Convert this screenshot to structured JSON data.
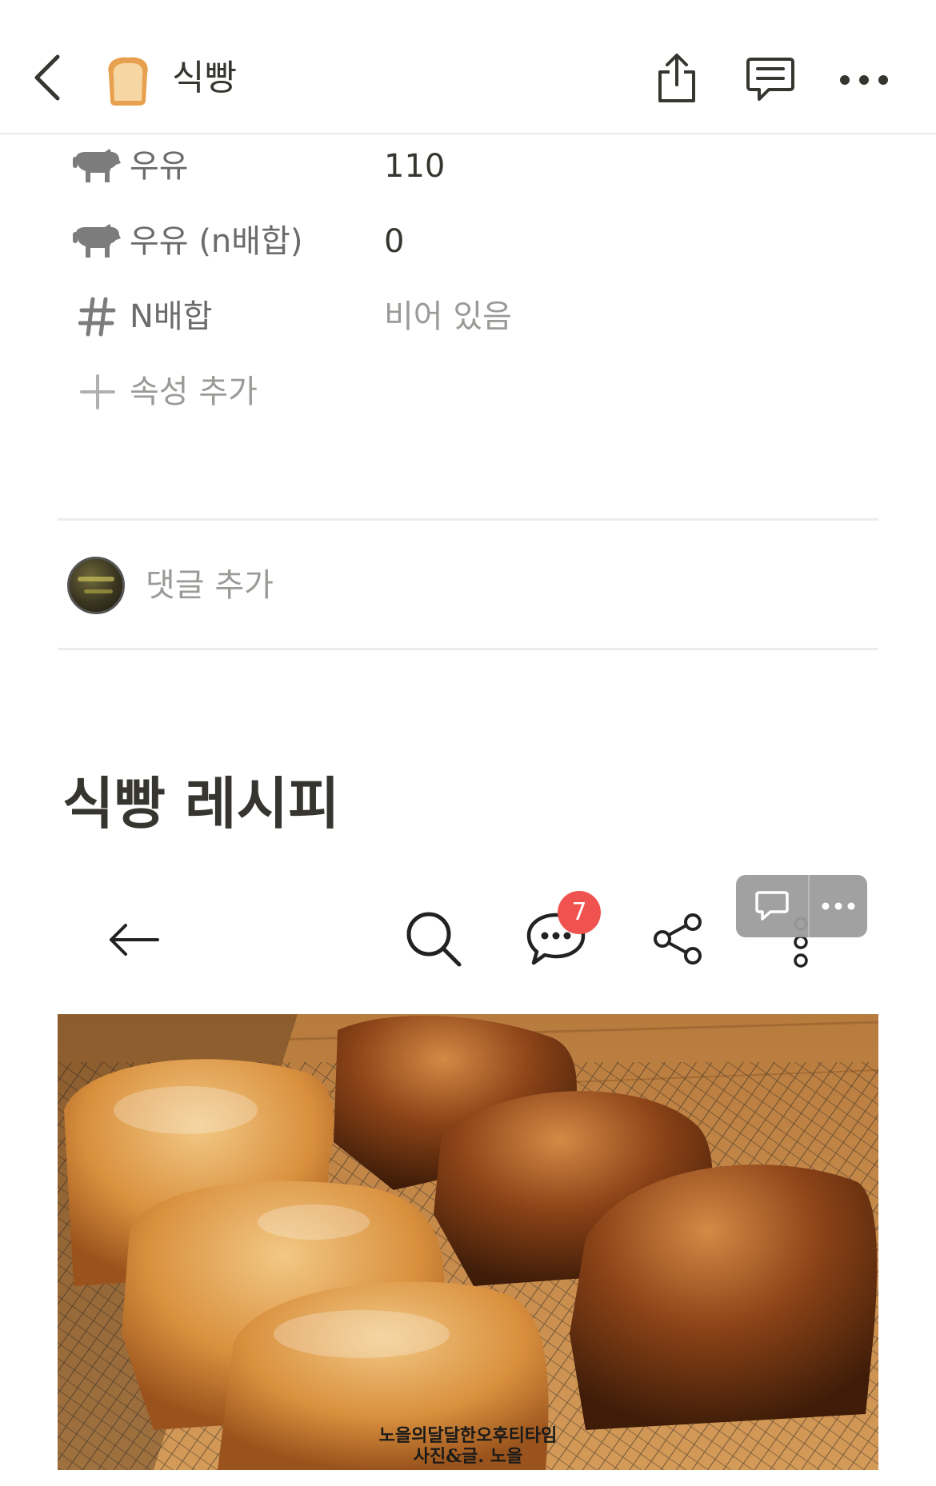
{
  "header": {
    "title": "식빵",
    "page_icon": "bread-icon",
    "actions": [
      "share-icon",
      "comments-icon",
      "more-icon"
    ]
  },
  "properties": [
    {
      "icon": "cow-icon",
      "label": "우유",
      "value": "110"
    },
    {
      "icon": "cow-icon",
      "label": "우유 (n배합)",
      "value": "0"
    },
    {
      "icon": "hash-icon",
      "label": "N배합",
      "value": "비어 있음"
    }
  ],
  "add_property_label": "속성 추가",
  "comment": {
    "placeholder": "댓글 추가"
  },
  "section_heading": "식빵 레시피",
  "viewer": {
    "comment_badge": "7",
    "icons": [
      "arrow-left-icon",
      "search-icon",
      "chat-bubble-icon",
      "share-nodes-icon",
      "kebab-icon"
    ]
  },
  "photo": {
    "caption_line1": "노을의달달한오후티타임",
    "caption_line2": "사진&글. 노을"
  },
  "colors": {
    "text": "#37352f",
    "muted": "#9b9a97",
    "badge": "#f0524f"
  }
}
